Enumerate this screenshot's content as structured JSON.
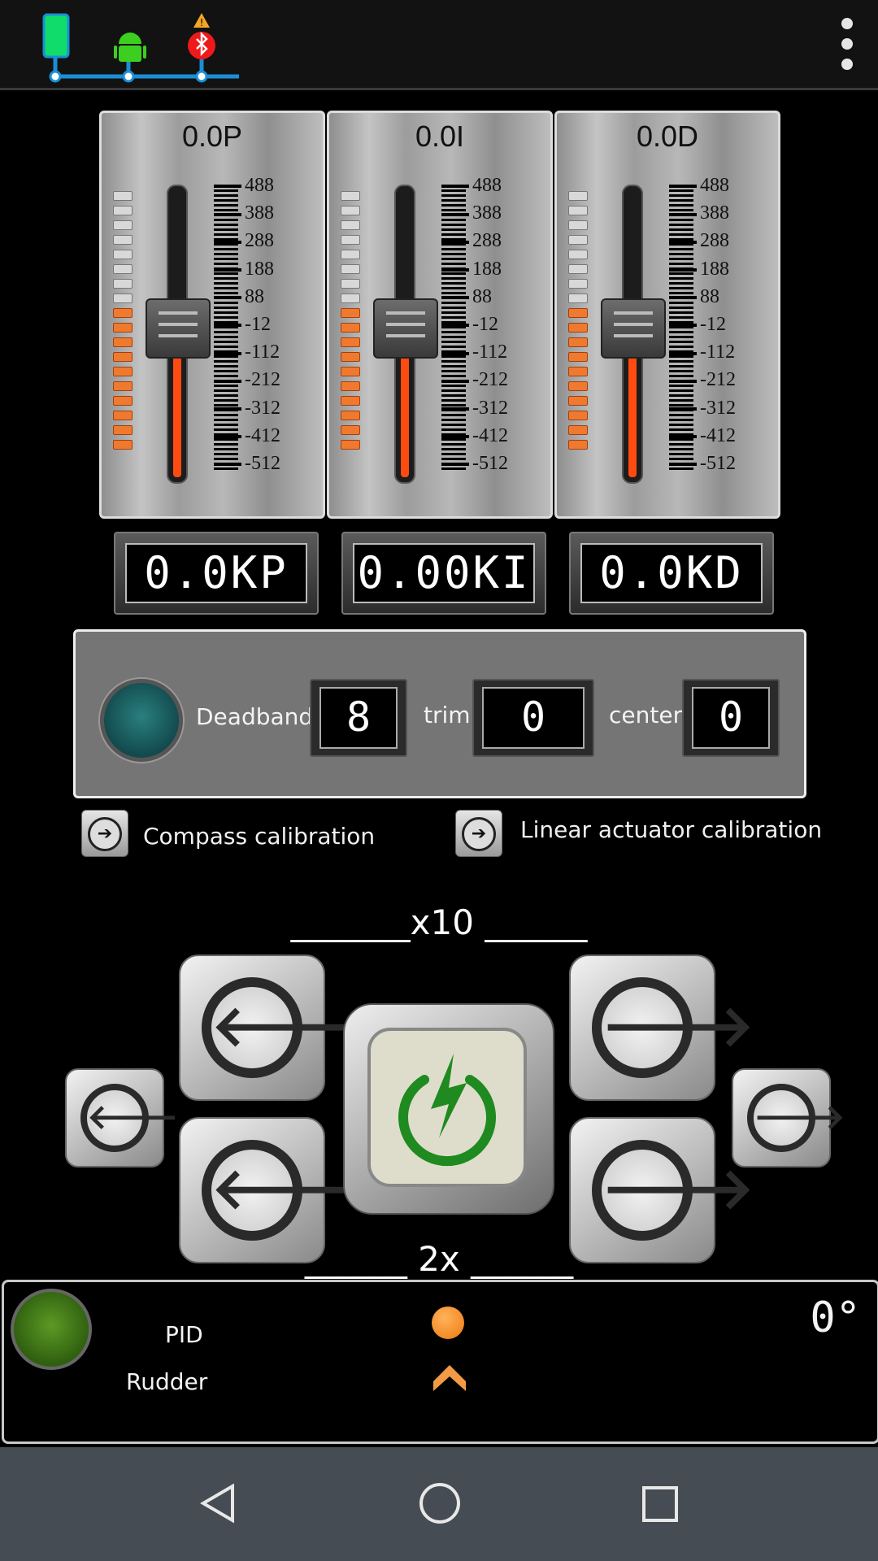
{
  "top_bar": {
    "icons": [
      "phone-icon",
      "android-icon",
      "warning-icon",
      "bluetooth-icon"
    ],
    "menu_icon": "more-vert-icon"
  },
  "sliders": [
    {
      "title": "0.0P",
      "display": "0.0KP",
      "scale": [
        "488",
        "388",
        "288",
        "188",
        "88",
        "-12",
        "-112",
        "-212",
        "-312",
        "-412",
        "-512"
      ],
      "level": 0.5
    },
    {
      "title": "0.0I",
      "display": "0.00KI",
      "scale": [
        "488",
        "388",
        "288",
        "188",
        "88",
        "-12",
        "-112",
        "-212",
        "-312",
        "-412",
        "-512"
      ],
      "level": 0.5
    },
    {
      "title": "0.0D",
      "display": "0.0KD",
      "scale": [
        "488",
        "388",
        "288",
        "188",
        "88",
        "-12",
        "-112",
        "-212",
        "-312",
        "-412",
        "-512"
      ],
      "level": 0.5
    }
  ],
  "settings": {
    "deadband_label": "Deadband",
    "deadband_value": "8",
    "trim_label": "trim",
    "trim_value": "0",
    "center_label": "center",
    "center_value": "0"
  },
  "calibration": {
    "compass": "Compass calibration",
    "linear": "Linear actuator calibration"
  },
  "controls": {
    "top_label": "_______x10 ______",
    "bottom_label": "______ 2x ______"
  },
  "status": {
    "pid_label": "PID",
    "rudder_label": "Rudder",
    "heading": "0°"
  },
  "colors": {
    "accent": "#ff4a10",
    "led_on": "#ef7a2f",
    "power_green": "#1f8a1f",
    "status_led": "#4a8a1c",
    "teal": "#1d6a6c"
  }
}
